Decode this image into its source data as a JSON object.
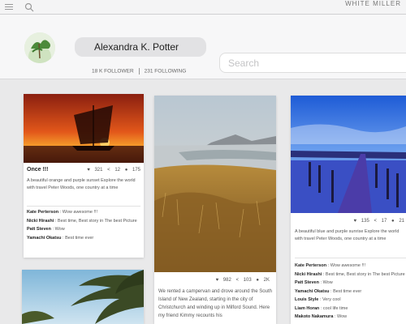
{
  "topbar": {
    "brand": "WHITE MILLER"
  },
  "profile": {
    "name": "Alexandra  K. Potter",
    "followers": "18 K  FOLLOWER",
    "following": "231 FOLLOWING",
    "search_placeholder": "Search"
  },
  "cards": [
    {
      "likes": "321",
      "shares": "12",
      "comments_count": "175",
      "title": "Once !!!",
      "description": "A beautiful orange and purple sunset Explore the world with travel Peter Woods, one country at a time",
      "comments": [
        {
          "user": "Kate  Perterson",
          "text": "Wow awesome !!!"
        },
        {
          "user": "Nicki  Hirashi",
          "text": "Best time, Best story in The best Picture"
        },
        {
          "user": "Patt Steven",
          "text": "Wow"
        },
        {
          "user": "Yamachi Okatsu",
          "text": "Best time ever"
        }
      ]
    },
    {
      "likes": "982",
      "shares": "103",
      "comments_count": "2K",
      "description": "We rented a campervan and drove around the South Island of New Zealand, starting in the city of Christchurch and winding up in Milford Sound. Here my friend Kimmy recounts his"
    },
    {
      "likes": "135",
      "shares": "17",
      "comments_count": "21",
      "description": "A beautiful blue and purple sunrise Explore the world with travel Peter Woods, one country at a time",
      "comments": [
        {
          "user": "Kate Perterson",
          "text": "Wow awesome !!!"
        },
        {
          "user": "Nicki  Hirashi",
          "text": "Best time, Best story in The best Picture"
        },
        {
          "user": "Patt Steven",
          "text": "Wow"
        },
        {
          "user": "Yamachi Okatsu",
          "text": "Best time ever"
        },
        {
          "user": "Louis Style",
          "text": "Very cool"
        },
        {
          "user": "Liam Horan",
          "text": "cool life time"
        },
        {
          "user": "Makoto Nakamura",
          "text": "Wow"
        }
      ]
    }
  ],
  "colors": {
    "accent": "#e9e9ea",
    "card": "#ffffff"
  }
}
